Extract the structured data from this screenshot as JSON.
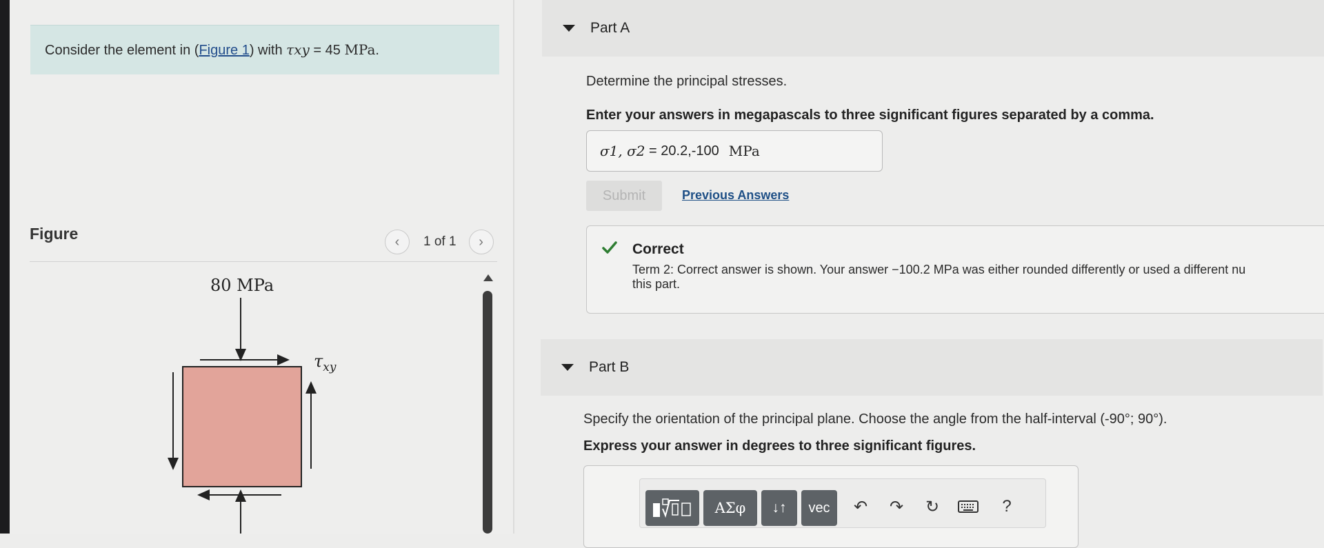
{
  "problem": {
    "prefix": "Consider the element in (",
    "figure_link": "Figure 1",
    "suffix": ") with ",
    "tau_symbol": "τxy",
    "equals": " = 45 ",
    "unit": "MPa",
    "period": "."
  },
  "figure": {
    "heading": "Figure",
    "counter": "1 of 1",
    "prev_icon": "chevron-left-icon",
    "next_icon": "chevron-right-icon",
    "stress_label": "80 MPa",
    "tau_label": "τ",
    "tau_sub": "xy",
    "element_fill": "#e2a49a"
  },
  "partA": {
    "title": "Part A",
    "question": "Determine the principal stresses.",
    "instruction": "Enter your answers in megapascals to three significant figures separated by a comma.",
    "answer_label": "σ1, σ2",
    "answer_eq": " = ",
    "answer_value": "20.2,-100",
    "answer_unit": "MPa",
    "submit_label": "Submit",
    "previous_answers": "Previous Answers",
    "feedback": {
      "status": "Correct",
      "text": "Term 2: Correct answer is shown. Your answer −100.2 MPa was either rounded differently or used a different nu",
      "text2": "this part.",
      "accent": "#2e7d32"
    }
  },
  "partB": {
    "title": "Part B",
    "question": "Specify the orientation of the principal plane. Choose the angle from the half-interval (-90°; 90°).",
    "instruction": "Express your answer in degrees to three significant figures.",
    "toolbar": {
      "templates": "templates-icon",
      "greek": "ΑΣφ",
      "updown": "↓↑",
      "vec": "vec",
      "undo": "undo-icon",
      "redo": "redo-icon",
      "reset": "reset-icon",
      "keyboard": "keyboard-icon",
      "help": "?"
    }
  }
}
